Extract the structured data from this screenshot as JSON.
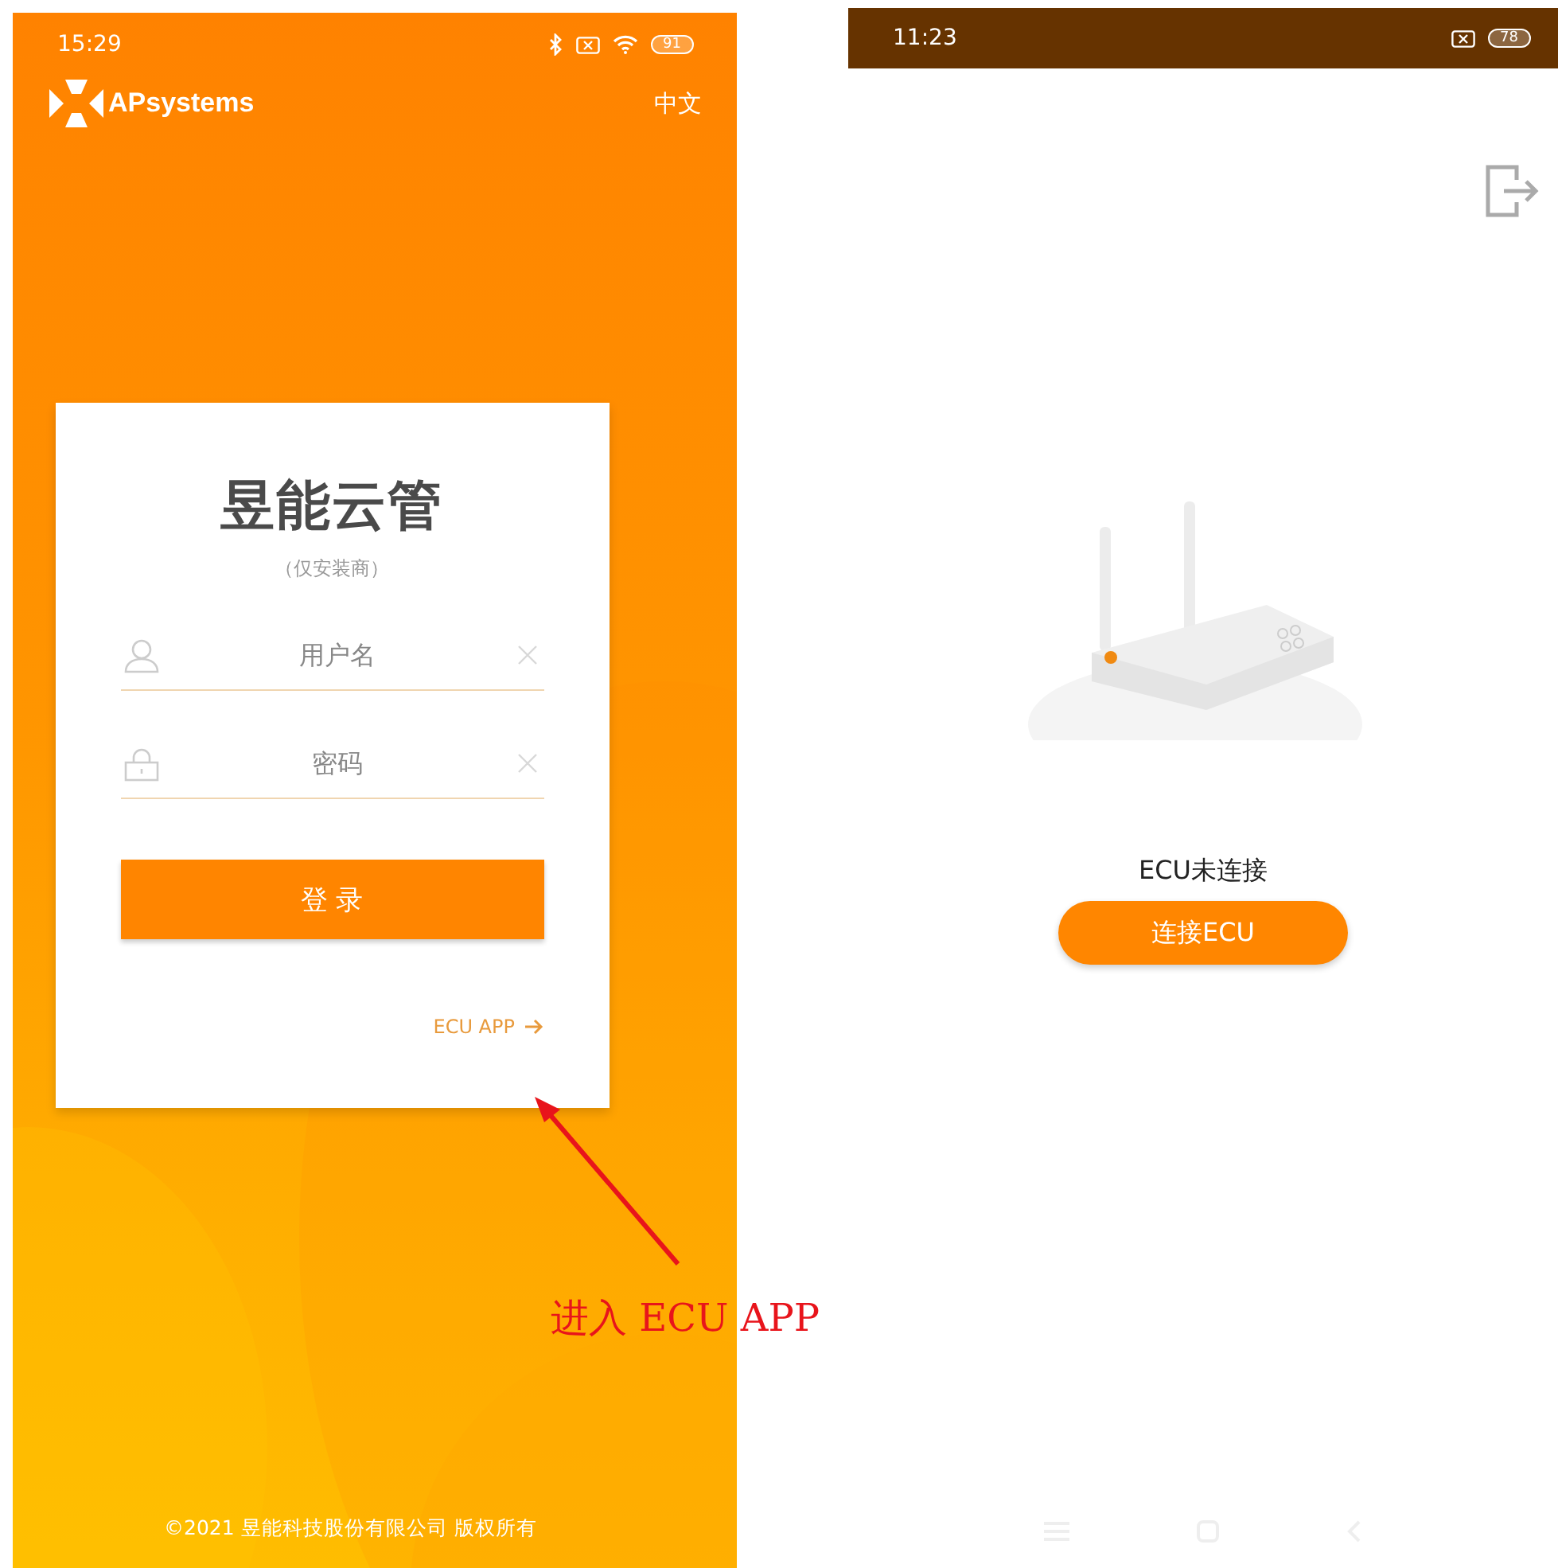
{
  "login_screen": {
    "status_bar": {
      "time": "15:29",
      "battery": "91"
    },
    "logo": {
      "text": "APsystems"
    },
    "language": "中文",
    "card": {
      "title": "昱能云管",
      "subtitle": "（仅安装商）",
      "fields": [
        {
          "kind": "user",
          "placeholder": "用户名"
        },
        {
          "kind": "password",
          "placeholder": "密码"
        }
      ],
      "login_button": "登 录",
      "ecu_link": "ECU APP"
    },
    "footer": "©2021 昱能科技股份有限公司 版权所有"
  },
  "ecu_screen": {
    "status_bar": {
      "time": "11:23",
      "battery": "78"
    },
    "status_text": "ECU未连接",
    "connect_button": "连接ECU"
  },
  "annotation": {
    "text": "进入 ECU APP"
  }
}
